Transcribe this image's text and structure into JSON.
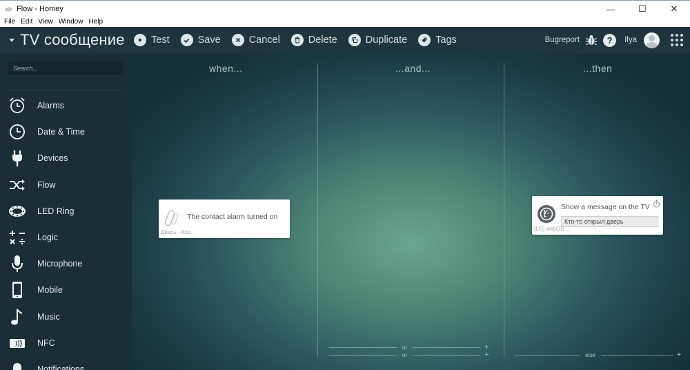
{
  "window": {
    "title": "Flow - Homey",
    "controls": {
      "minimize": "—",
      "maximize": "☐",
      "close": "✕"
    }
  },
  "menu": [
    "File",
    "Edit",
    "View",
    "Window",
    "Help"
  ],
  "toolbar": {
    "flow_name": "TV сообщение",
    "buttons": [
      {
        "label": "Test",
        "icon": "play-icon"
      },
      {
        "label": "Save",
        "icon": "check-icon"
      },
      {
        "label": "Cancel",
        "icon": "close-icon"
      },
      {
        "label": "Delete",
        "icon": "trash-icon"
      },
      {
        "label": "Duplicate",
        "icon": "duplicate-icon"
      },
      {
        "label": "Tags",
        "icon": "tag-icon"
      }
    ],
    "bugreport": "Bugreport",
    "help": "?",
    "user": "Ilya"
  },
  "sidebar": {
    "search_placeholder": "Search...",
    "items": [
      {
        "label": "Alarms",
        "icon": "alarm-clock-icon"
      },
      {
        "label": "Date & Time",
        "icon": "clock-icon"
      },
      {
        "label": "Devices",
        "icon": "plug-icon"
      },
      {
        "label": "Flow",
        "icon": "shuffle-icon"
      },
      {
        "label": "LED Ring",
        "icon": "led-ring-icon"
      },
      {
        "label": "Logic",
        "icon": "math-operators-icon"
      },
      {
        "label": "Microphone",
        "icon": "microphone-icon"
      },
      {
        "label": "Mobile",
        "icon": "mobile-phone-icon"
      },
      {
        "label": "Music",
        "icon": "music-note-icon"
      },
      {
        "label": "NFC",
        "icon": "nfc-icon"
      },
      {
        "label": "Notifications",
        "icon": "bell-icon"
      }
    ]
  },
  "columns": {
    "when": "when...",
    "and": "...and...",
    "then": "...then"
  },
  "cards": {
    "when_card": {
      "title": "The contact alarm turned on",
      "device": "Дверь - Кор..",
      "icon": "contact-sensor-icon"
    },
    "then_card": {
      "title": "Show a message on the TV",
      "message": "Кто-то открыл дверь",
      "device": "[LG] webOS ...",
      "icon": "lg-logo-icon",
      "timer_icon": "stopwatch-icon"
    }
  },
  "footers": {
    "or": "or",
    "else": "else",
    "plus": "+"
  }
}
